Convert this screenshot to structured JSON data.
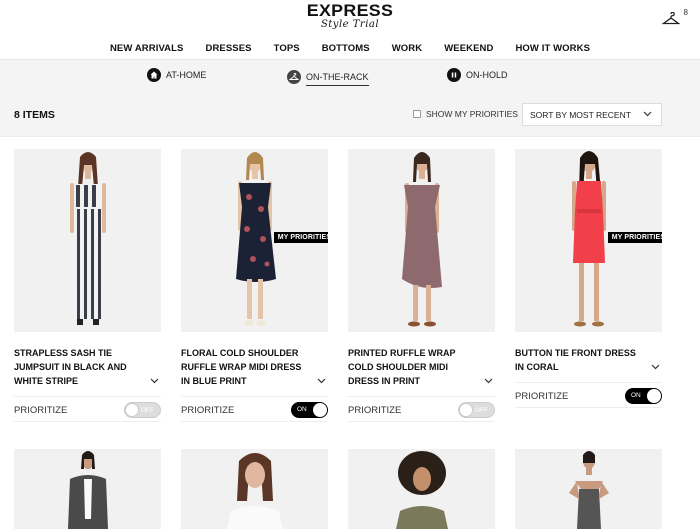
{
  "header": {
    "brand": "EXPRESS",
    "subtitle": "Style Trial",
    "cart_count": "8",
    "cart_icon": "hanger-icon"
  },
  "nav": {
    "items": [
      "NEW ARRIVALS",
      "DRESSES",
      "TOPS",
      "BOTTOMS",
      "WORK",
      "WEEKEND",
      "HOW IT WORKS"
    ]
  },
  "status_tabs": [
    {
      "label": "AT-HOME",
      "icon": "home-icon",
      "active": false
    },
    {
      "label": "ON-THE-RACK",
      "icon": "hanger-icon",
      "active": true
    },
    {
      "label": "ON-HOLD",
      "icon": "pause-icon",
      "active": false
    }
  ],
  "toolbar": {
    "items_count": "8 ITEMS",
    "show_priorities_label": "SHOW MY PRIORITIES",
    "show_priorities_checked": false,
    "sort_selected": "SORT BY MOST RECENT"
  },
  "products": [
    {
      "title": "STRAPLESS SASH TIE JUMPSUIT IN BLACK AND WHITE STRIPE",
      "prioritize_label": "PRIORITIZE",
      "prioritized": false,
      "toggle_text": "OFF",
      "badge": null,
      "colors": {
        "garment": "#f5f5f5",
        "accent": "#333344"
      }
    },
    {
      "title": "FLORAL COLD SHOULDER RUFFLE WRAP MIDI DRESS IN BLUE PRINT",
      "prioritize_label": "PRIORITIZE",
      "prioritized": true,
      "toggle_text": "ON",
      "badge": "MY PRIORITIES",
      "colors": {
        "garment": "#1c2236",
        "accent": "#b0525a"
      }
    },
    {
      "title": "PRINTED RUFFLE WRAP COLD SHOULDER MIDI DRESS IN PRINT",
      "prioritize_label": "PRIORITIZE",
      "prioritized": false,
      "toggle_text": "OFF",
      "badge": null,
      "colors": {
        "garment": "#8e6a6e",
        "accent": "#6a4a50"
      }
    },
    {
      "title": "BUTTON TIE FRONT DRESS IN CORAL",
      "prioritize_label": "PRIORITIZE",
      "prioritized": true,
      "toggle_text": "ON",
      "badge": "MY PRIORITIES",
      "colors": {
        "garment": "#f2404a",
        "accent": "#d63640"
      }
    },
    {
      "colors": {
        "garment": "#4a4a4a"
      }
    },
    {
      "colors": {
        "garment": "#fafafa"
      }
    },
    {
      "colors": {
        "garment": "#7a7a5a"
      }
    },
    {
      "colors": {
        "garment": "#555555"
      }
    }
  ]
}
